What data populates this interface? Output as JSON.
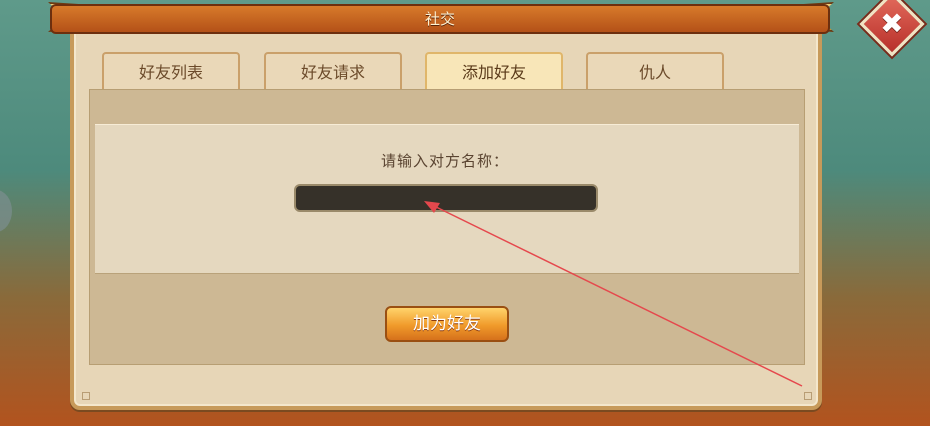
{
  "window": {
    "title": "社交"
  },
  "tabs": [
    {
      "label": "好友列表",
      "active": false
    },
    {
      "label": "好友请求",
      "active": false
    },
    {
      "label": "添加好友",
      "active": true
    },
    {
      "label": "仇人",
      "active": false
    }
  ],
  "add_friend": {
    "prompt": "请输入对方名称：",
    "input_value": "",
    "button_label": "加为好友"
  },
  "colors": {
    "title_bar": "#c4601f",
    "panel": "#e7d6b7",
    "button": "#f09a2a",
    "close": "#c0392b",
    "annotation": "#e5484d"
  },
  "icons": {
    "close": "close-icon"
  }
}
